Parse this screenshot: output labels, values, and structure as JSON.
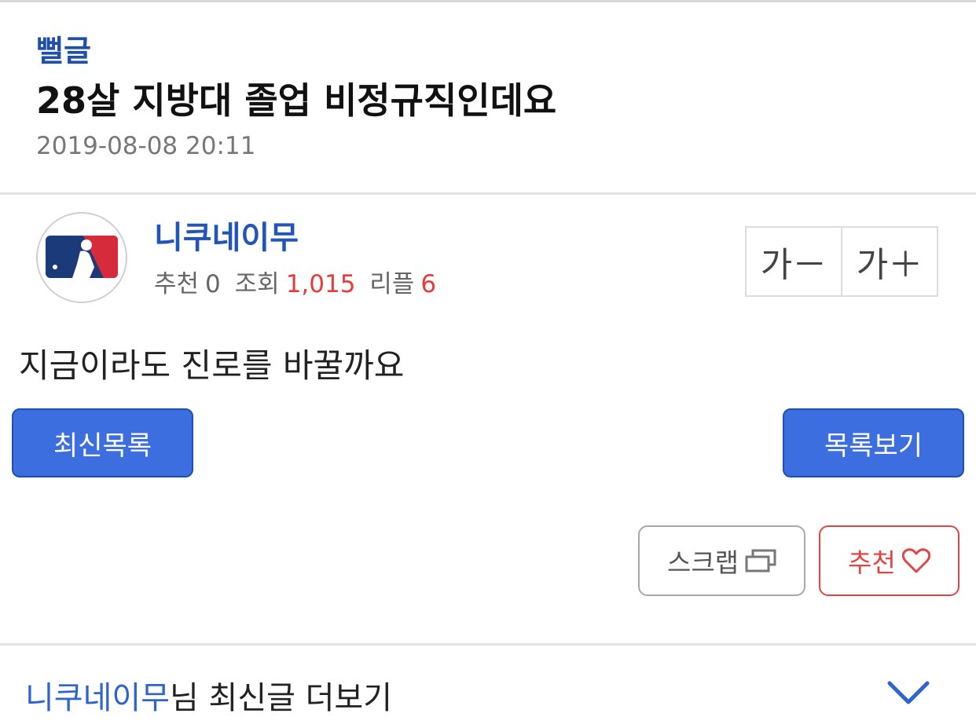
{
  "post": {
    "category": "뻘글",
    "title": "28살 지방대 졸업 비정규직인데요",
    "date": "2019-08-08 20:11",
    "content": "지금이라도 진로를 바꿀까요"
  },
  "author": {
    "nickname": "니쿠네이무",
    "avatar_icon": "mlb-logo-icon",
    "rec_label": "추천",
    "rec_count": "0",
    "views_label": "조회",
    "views_count": "1,015",
    "reply_label": "리플",
    "reply_count": "6"
  },
  "font_size": {
    "decrease_label": "가－",
    "increase_label": "가＋"
  },
  "nav": {
    "latest_label": "최신목록",
    "list_label": "목록보기"
  },
  "actions": {
    "scrap_label": "스크랩",
    "scrap_icon": "copy-windows-icon",
    "recommend_label": "추천",
    "recommend_icon": "heart-outline-icon"
  },
  "more_posts": {
    "nickname": "니쿠네이무",
    "suffix": "님 최신글 더보기",
    "icon": "chevron-down-icon"
  },
  "colors": {
    "accent_blue": "#3c6ee0",
    "nickname_blue": "#2255b8",
    "highlight_red": "#e63b3b",
    "recommend_red": "#e24444"
  }
}
